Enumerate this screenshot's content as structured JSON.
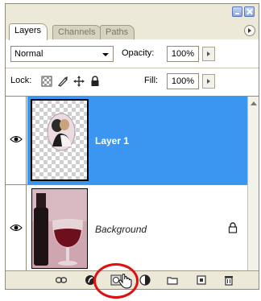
{
  "tabs": [
    {
      "label": "Layers",
      "active": true
    },
    {
      "label": "Channels",
      "active": false
    },
    {
      "label": "Paths",
      "active": false
    }
  ],
  "blend_mode": "Normal",
  "opacity": {
    "label": "Opacity:",
    "value": "100%"
  },
  "lock": {
    "label": "Lock:",
    "icons": [
      "lock-transparent-icon",
      "lock-image-icon",
      "lock-position-icon",
      "lock-all-icon"
    ]
  },
  "fill": {
    "label": "Fill:",
    "value": "100%"
  },
  "layers": [
    {
      "name": "Layer 1",
      "selected": true,
      "visible": true
    },
    {
      "name": "Background",
      "selected": false,
      "visible": true,
      "locked": true
    }
  ],
  "bottom_icons": [
    "link-icon",
    "layer-style-icon",
    "add-mask-icon",
    "adjustment-layer-icon",
    "new-group-icon",
    "new-layer-icon",
    "trash-icon"
  ],
  "colors": {
    "selection": "#3b96f2",
    "highlight": "#e01010"
  }
}
